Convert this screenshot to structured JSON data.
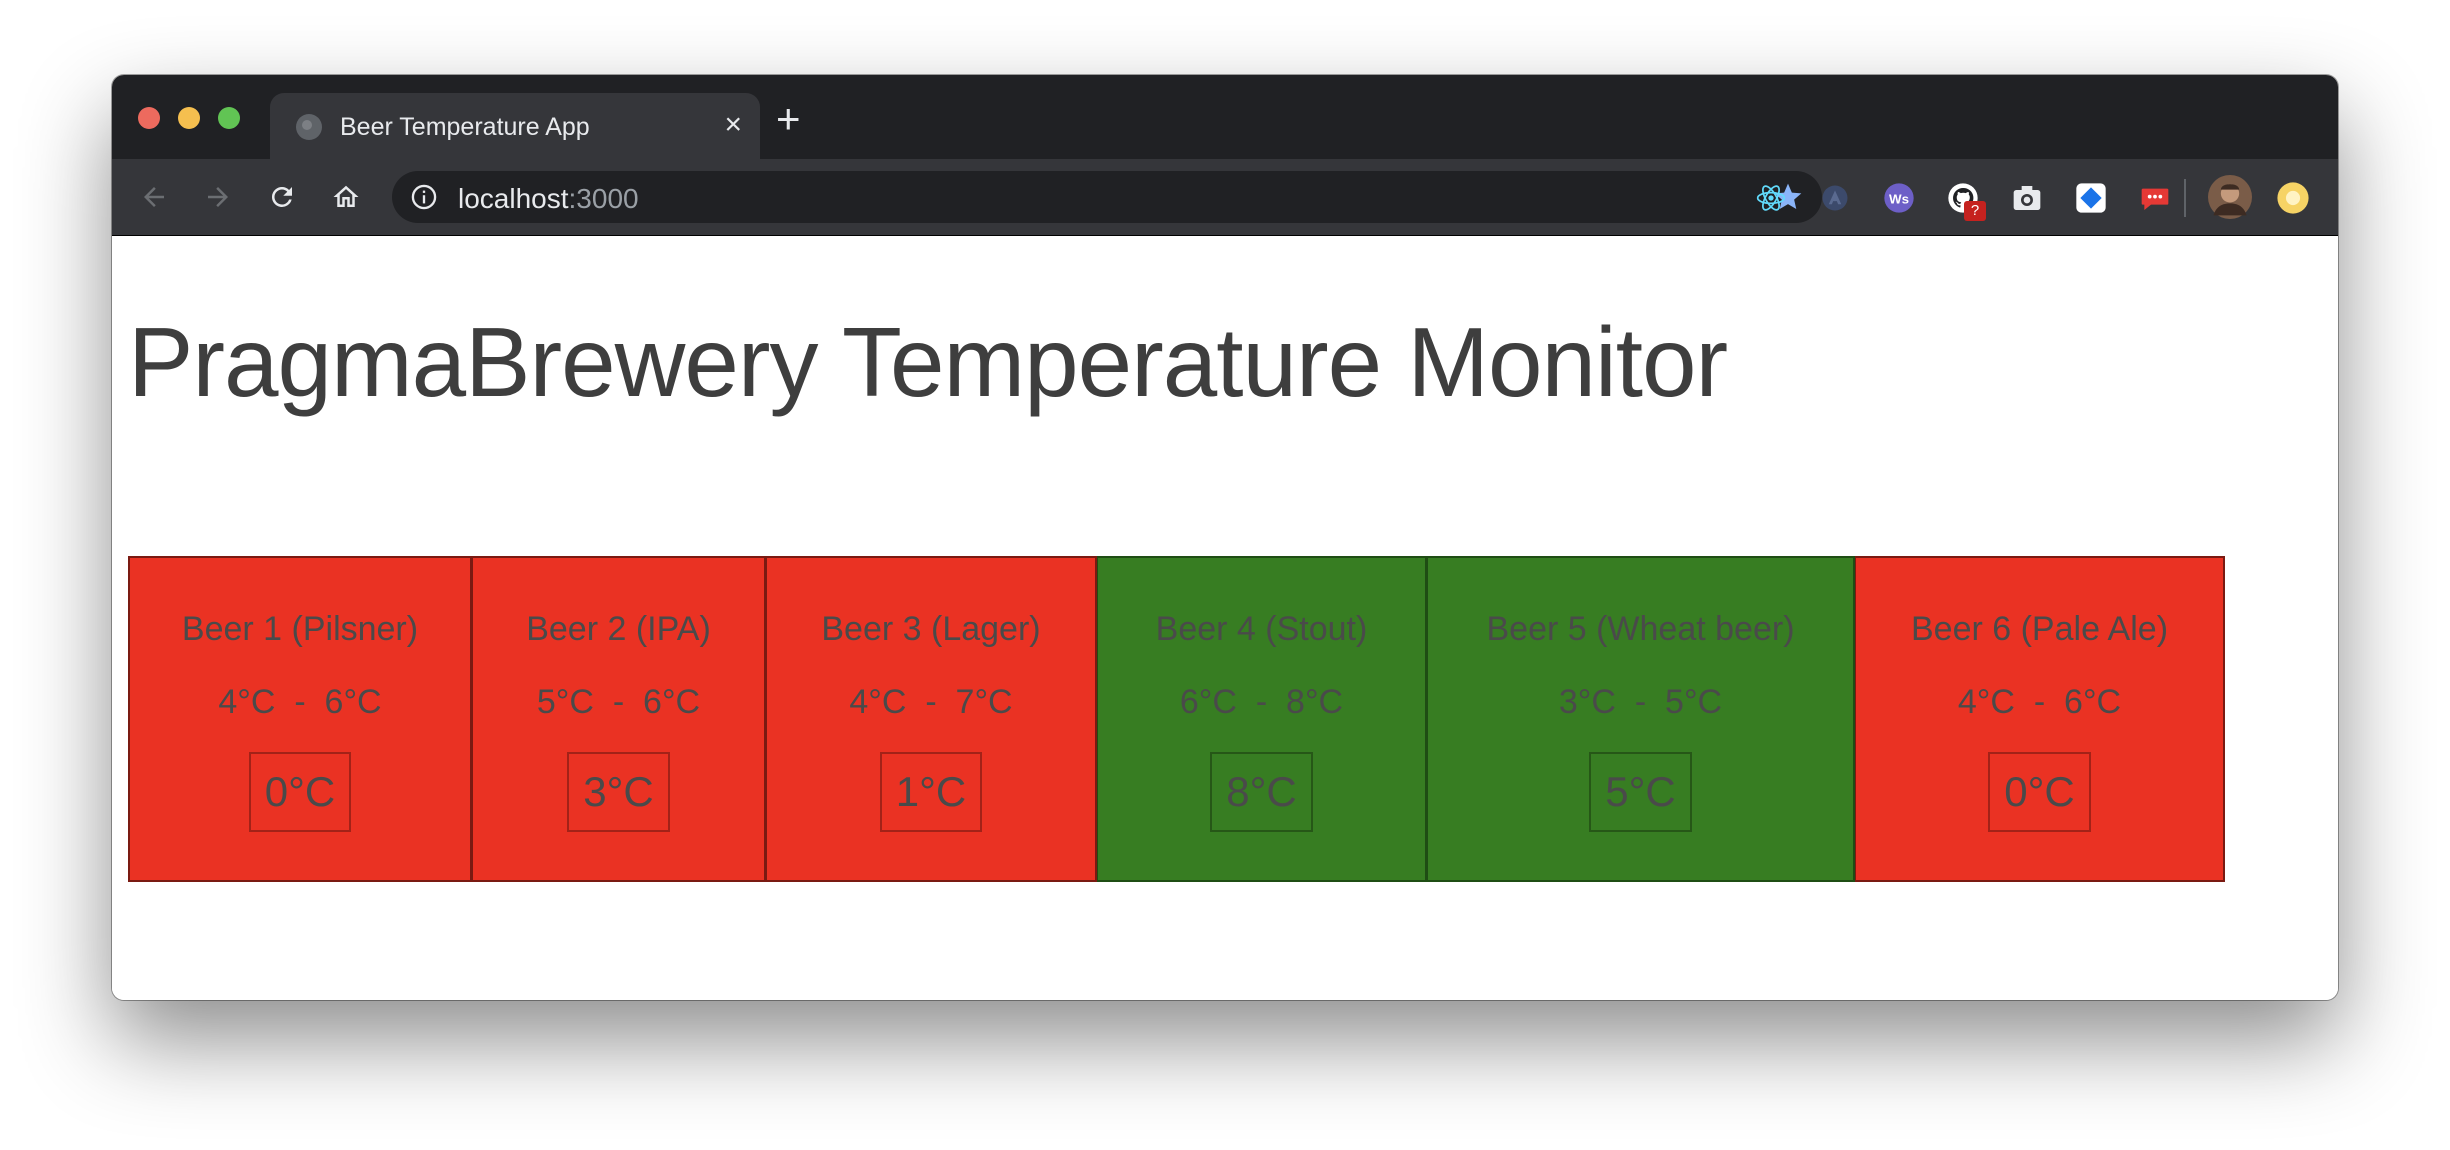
{
  "browser": {
    "tab_title": "Beer Temperature App",
    "tab_close": "×",
    "new_tab": "+",
    "url_host": "localhost",
    "url_port": ":3000",
    "extensions": [
      "react-devtools-icon",
      "extension-icon",
      "websocket-icon",
      "github-icon",
      "screenshot-icon",
      "diamond-icon",
      "chat-icon",
      "profile-avatar",
      "extension-circle-icon"
    ],
    "extension_badge": "?",
    "colors": {
      "tabbar": "#202124",
      "toolbar": "#35363a",
      "omnibox": "#202124",
      "star": "#8ab4f8"
    }
  },
  "page": {
    "title": "PragmaBrewery Temperature Monitor",
    "colors": {
      "alert": "#ea3223",
      "ok": "#377d22"
    },
    "beers": [
      {
        "name": "Beer 1 (Pilsner)",
        "range": "4°C  -  6°C",
        "temperature": "0°C",
        "status": "alert"
      },
      {
        "name": "Beer 2 (IPA)",
        "range": "5°C  -  6°C",
        "temperature": "3°C",
        "status": "alert"
      },
      {
        "name": "Beer 3 (Lager)",
        "range": "4°C  -  7°C",
        "temperature": "1°C",
        "status": "alert"
      },
      {
        "name": "Beer 4 (Stout)",
        "range": "6°C  -  8°C",
        "temperature": "8°C",
        "status": "ok"
      },
      {
        "name": "Beer 5 (Wheat beer)",
        "range": "3°C  -  5°C",
        "temperature": "5°C",
        "status": "ok"
      },
      {
        "name": "Beer 6 (Pale Ale)",
        "range": "4°C  -  6°C",
        "temperature": "0°C",
        "status": "alert"
      }
    ]
  }
}
